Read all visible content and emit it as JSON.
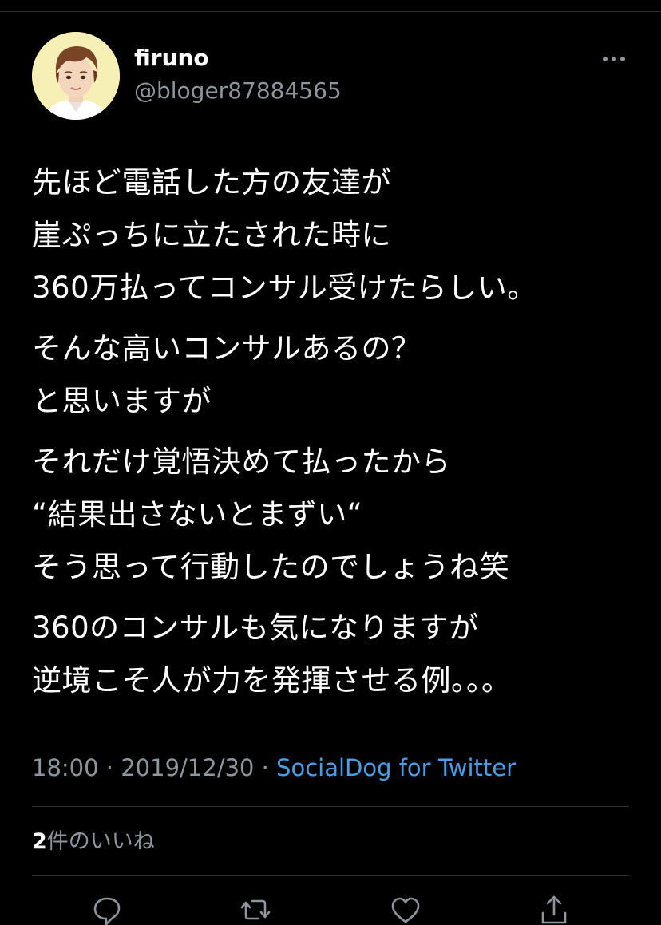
{
  "tweet": {
    "display_name": "firuno",
    "handle": "@bloger87884565",
    "paragraphs": [
      [
        "先ほど電話した方の友達が",
        "崖ぷっちに立たされた時に",
        "360万払ってコンサル受けたらしい。"
      ],
      [
        "そんな高いコンサルあるの？",
        "と思いますが"
      ],
      [
        "それだけ覚悟決めて払ったから",
        "“結果出さないとまずい“",
        "そう思って行動したのでしょうね笑"
      ],
      [
        "360のコンサルも気になりますが",
        "逆境こそ人が力を発揮させる例。。。"
      ]
    ],
    "time": "18:00",
    "separator": "·",
    "date": "2019/12/30",
    "source": "SocialDog for Twitter",
    "likes_count": "2",
    "likes_label": "件のいいね"
  },
  "icons": {
    "more": "more-horizontal-icon",
    "reply": "reply-icon",
    "retweet": "retweet-icon",
    "like": "heart-icon",
    "share": "share-icon"
  },
  "colors": {
    "background": "#000000",
    "text": "#ffffff",
    "secondary": "#8d959d",
    "link": "#4b9ee6",
    "divider": "#2f3336",
    "avatar_bg": "#f7f0b6"
  }
}
